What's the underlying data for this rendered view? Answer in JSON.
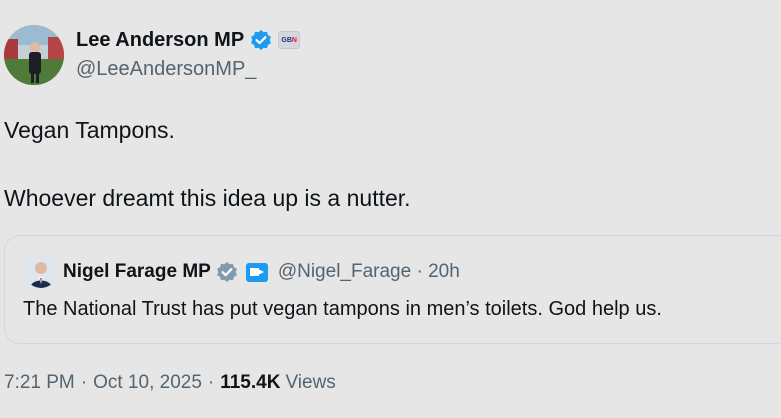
{
  "author": {
    "display_name": "Lee Anderson MP",
    "handle": "@LeeAndersonMP_",
    "affiliate_badge_text": "GB",
    "verified_color": "#1d9bf0"
  },
  "tweet": {
    "line1": "Vegan Tampons.",
    "line2": "Whoever dreamt this idea up is a nutter."
  },
  "quoted": {
    "display_name": "Nigel Farage MP",
    "handle_time": "@Nigel_Farage · 20h",
    "text": "The National Trust has put vegan tampons in men’s toilets. God help us."
  },
  "footer": {
    "time": "7:21 PM",
    "date": "Oct 10, 2025",
    "views_count": "115.4K",
    "views_label": "Views",
    "separator": "·"
  }
}
